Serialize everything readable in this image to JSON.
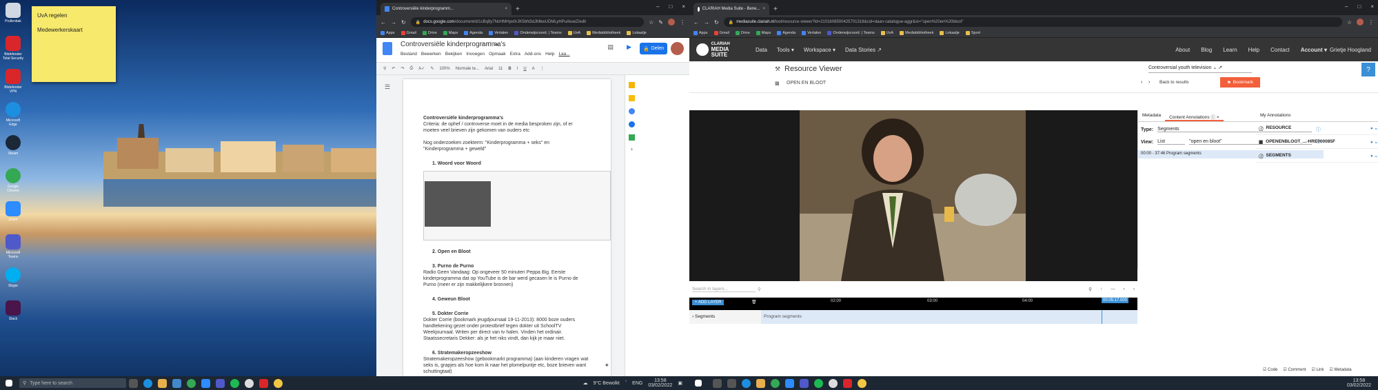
{
  "desktop": {
    "icons": [
      {
        "label": "Prullenbak",
        "color": "#cfd8e3"
      },
      {
        "label": "Bitdefender Total Security",
        "color": "#d9262b"
      },
      {
        "label": "Bitdefender VPN",
        "color": "#d9262b"
      },
      {
        "label": "Microsoft Edge",
        "color": "#1d8fe0"
      },
      {
        "label": "Steam",
        "color": "#1b2838"
      },
      {
        "label": "Google Chrome",
        "color": "#34a853"
      },
      {
        "label": "Zoom",
        "color": "#2d8cff"
      },
      {
        "label": "Microsoft Teams",
        "color": "#5059c9"
      },
      {
        "label": "Skype",
        "color": "#00aff0"
      },
      {
        "label": "Slack",
        "color": "#4a154b"
      }
    ],
    "sticky": [
      "UvA regelen",
      "Medewerkerskaart"
    ]
  },
  "taskbar_left": {
    "search_placeholder": "Type here to search",
    "weather": "9°C Bewolkt",
    "lang": "ENG",
    "time": "13:58",
    "date": "03/02/2022"
  },
  "taskbar_right": {
    "time": "13:58",
    "date": "03/02/2022"
  },
  "docs_window": {
    "tab_title": "Controversiële kinderprogramm...",
    "url_host": "docs.google.com",
    "url_path": "/document/d/1cBq9y7NcHMHpx0rJK5bN3dJMbwUDMLyHPuAluwZ/edit",
    "bookmarks": [
      "Apps",
      "Gmail",
      "Drive",
      "Maps",
      "Agenda",
      "Vertalen",
      "Onderwijscoord. | Teams",
      "UvA",
      "Mediabibliotheek",
      "Lokaalje"
    ],
    "title": "Controversiële kinderprogramma's",
    "menu": [
      "Bestand",
      "Bewerken",
      "Bekijken",
      "Invoegen",
      "Opmaak",
      "Extra",
      "Add-ons",
      "Help",
      "Laa..."
    ],
    "share_label": "Delen",
    "toolbar": {
      "zoom": "100%",
      "style": "Normale te...",
      "font": "Arial",
      "size": "11"
    },
    "doc": {
      "heading": "Controversiële kinderprogramma's",
      "intro": "Criteria: de ophef / controverse moet in de media besproken zijn, of er moeten veel brieven zijn gekomen van ouders etc",
      "search": "Nog onderzoeken zoekterm: \"Kinderprogramma + seks\" en \"Kinderprogramma + geweld\"",
      "items": [
        {
          "h": "1.  Woord voor Woord",
          "t": ""
        },
        {
          "h": "2.  Open en Bloot",
          "t": ""
        },
        {
          "h": "3.  Purno de Purno",
          "t": "Radio Geen Vandaag: Op ongeveer 50 minuten Peppa Big. Eerste kinderprogramma dat op YouTube is de bar werd gecasen le is Purno de Purno (meer er zijn makkelijkere bronnen)"
        },
        {
          "h": "4.  Geweun Bloot",
          "t": ""
        },
        {
          "h": "5.  Dokter Corrie",
          "t": "Dokter Corrie (bookmark jeugdjournaal 19-11-2013): 8000 boze ouders handtekening gezet onder protestbrief tegen dokter uit SchoolTV Weekjournaal. Writen per direct van tv halen. Vinden het ordinair. Staatssecretaris Dekker: als je het niks vindt, dan kijk je maar niet."
        },
        {
          "h": "6.  Stratemakeropzeeshow",
          "t": "Stratemakeropzeeshow (gebookmarkt programma) (aan kinderen vragen wat seks is, grapjes als hoe kom ik naar het plomelpuntje etc, boze brieven want schuttingtaal)"
        }
      ]
    }
  },
  "ms_window": {
    "tab_title": "CLARIAH Media Suite - Bene...",
    "url_host": "mediasuite.clariah.nl",
    "url_path": "/tool/resource-viewer?id=2101608500425701318&cid=daan-catalogue-aggr&st=\"open%20en%20bloot\"",
    "bookmarks": [
      "Apps",
      "Gmail",
      "Drive",
      "Maps",
      "Agenda",
      "Vertalen",
      "Onderwijscoord. | Teams",
      "UvA",
      "Mediabibliotheek",
      "Lokaalje",
      "Sport"
    ],
    "logo_top": "CLARIAH",
    "logo_bottom": "MEDIA SUITE",
    "nav": [
      "Data",
      "Tools",
      "Workspace",
      "Data Stories"
    ],
    "nav_right": [
      "About",
      "Blog",
      "Learn",
      "Help",
      "Contact",
      "Account",
      "Grietje Hoogland"
    ],
    "viewer_title": "Resource Viewer",
    "resource": "OPEN EN BLOOT",
    "collection": "Controversial youth television",
    "back": "Back to results",
    "bookmark": "Bookmark",
    "help": "?",
    "panel_tabs": [
      "Metadata",
      "Content Annotations",
      "My Annotations"
    ],
    "type_label": "Type:",
    "type_value": "Segments",
    "view_label": "View:",
    "view_value": "List",
    "search_value": "\"open en bloot\"",
    "segment_row": "00:00 - 37:46  Program segments",
    "right_segments": [
      "RESOURCE",
      "OPENENBLOOT_...-HRE000085F",
      "SEGMENTS"
    ],
    "search_layers": "Search in layers...",
    "add_layer": "+ ADD LAYER",
    "layer": "Segments",
    "layer_bar": "Program segments",
    "ticks": [
      "02:00",
      "03:00",
      "04:00"
    ],
    "playhead": "00:05:17.000",
    "footer_checks": [
      "Code",
      "Comment",
      "Link",
      "Metadata"
    ]
  }
}
